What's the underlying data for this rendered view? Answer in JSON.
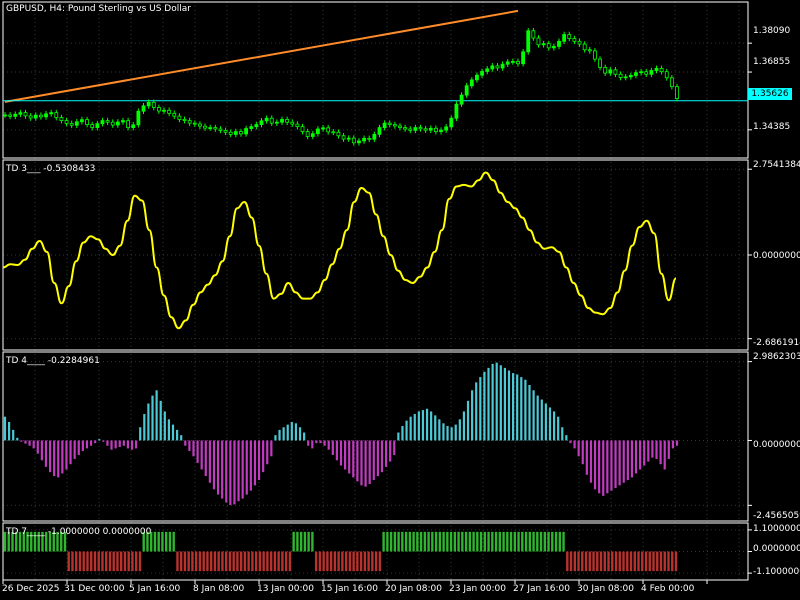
{
  "header": {
    "symbol_title": "GBPUSD, H4:  Pound Sterling vs US Dollar",
    "current_price": "1.35626"
  },
  "colors": {
    "background": "#000000",
    "grid": "#2e3a2e",
    "frame": "#ffffff",
    "bull_candle": "#00ff00",
    "trendline": "#ff8c28",
    "price_line": "#00ffff",
    "td3_line": "#ffff00",
    "td4_pos": "#4dc9d6",
    "td4_neg": "#c23cc2",
    "td7_up": "#2fb52f",
    "td7_down": "#b8322e"
  },
  "panes": {
    "price": {
      "y_ticks": [
        "1.38090",
        "1.36855",
        "1.34385"
      ],
      "y_tick_values": [
        1.3809,
        1.36855,
        1.34385
      ],
      "range": [
        1.3318,
        1.3985
      ],
      "trendline": {
        "start": 1.3558,
        "end": 1.3947
      },
      "closes": [
        1.3502,
        1.3496,
        1.3505,
        1.3512,
        1.3498,
        1.3489,
        1.3501,
        1.3494,
        1.3507,
        1.3512,
        1.3491,
        1.3478,
        1.3466,
        1.3458,
        1.3473,
        1.3482,
        1.3461,
        1.3448,
        1.3465,
        1.3478,
        1.3471,
        1.3459,
        1.3472,
        1.3478,
        1.3448,
        1.346,
        1.3518,
        1.3541,
        1.3556,
        1.3534,
        1.3519,
        1.3522,
        1.3509,
        1.3497,
        1.3483,
        1.3478,
        1.3467,
        1.3463,
        1.3454,
        1.3446,
        1.3448,
        1.3442,
        1.3436,
        1.3428,
        1.3419,
        1.3431,
        1.3421,
        1.3444,
        1.3452,
        1.3461,
        1.3477,
        1.3488,
        1.3467,
        1.3471,
        1.3483,
        1.3471,
        1.3463,
        1.3452,
        1.3431,
        1.341,
        1.3422,
        1.3442,
        1.3447,
        1.343,
        1.3428,
        1.3413,
        1.3399,
        1.3403,
        1.3383,
        1.3391,
        1.3402,
        1.3398,
        1.3419,
        1.3448,
        1.3467,
        1.3461,
        1.3455,
        1.3448,
        1.3442,
        1.3436,
        1.3448,
        1.3443,
        1.3437,
        1.3445,
        1.3431,
        1.3437,
        1.3451,
        1.3488,
        1.3548,
        1.3587,
        1.3627,
        1.3652,
        1.3672,
        1.3688,
        1.3699,
        1.3712,
        1.3703,
        1.3719,
        1.3729,
        1.3731,
        1.3721,
        1.3772,
        1.3862,
        1.3831,
        1.3802,
        1.3807,
        1.3789,
        1.3795,
        1.3817,
        1.3846,
        1.3829,
        1.3817,
        1.3805,
        1.3781,
        1.3776,
        1.3741,
        1.3705,
        1.3681,
        1.3695,
        1.3676,
        1.3662,
        1.3665,
        1.3671,
        1.3683,
        1.3687,
        1.3676,
        1.3692,
        1.3701,
        1.3687,
        1.3661,
        1.3623,
        1.3572
      ]
    },
    "td3": {
      "title": "TD 3___  -0.5308433",
      "y_ticks": [
        "2.7541384",
        "0.0000000",
        "-2.6861914"
      ],
      "y_tick_values": [
        2.7541384,
        0,
        -2.6861914
      ],
      "range": [
        -3.05,
        3.05
      ],
      "values": [
        -0.4,
        -0.3,
        -0.32,
        -0.15,
        0.2,
        0.45,
        0.1,
        -0.9,
        -1.55,
        -1.0,
        -0.2,
        0.4,
        0.6,
        0.5,
        0.2,
        0.0,
        0.3,
        1.1,
        1.9,
        1.75,
        0.8,
        -0.4,
        -1.3,
        -2.0,
        -2.35,
        -2.1,
        -1.6,
        -1.2,
        -0.95,
        -0.65,
        -0.2,
        0.6,
        1.5,
        1.7,
        1.2,
        0.3,
        -0.6,
        -1.4,
        -1.25,
        -0.9,
        -1.2,
        -1.4,
        -1.4,
        -1.2,
        -0.8,
        -0.3,
        0.2,
        0.8,
        1.7,
        2.15,
        2.0,
        1.3,
        0.6,
        0.0,
        -0.5,
        -0.8,
        -0.9,
        -0.7,
        -0.4,
        0.1,
        0.8,
        1.8,
        2.2,
        2.25,
        2.2,
        2.4,
        2.65,
        2.4,
        2.0,
        1.7,
        1.5,
        1.2,
        0.8,
        0.4,
        0.2,
        0.25,
        0.1,
        -0.4,
        -0.9,
        -1.3,
        -1.7,
        -1.85,
        -1.9,
        -1.7,
        -1.2,
        -0.5,
        0.3,
        0.9,
        1.1,
        0.7,
        -0.6,
        -1.45,
        -0.75
      ]
    },
    "td4": {
      "title": "TD 4____  -0.2284961",
      "y_ticks": [
        "2.9862303",
        "0.0000000",
        "-2.4565059"
      ],
      "y_tick_values": [
        2.9862303,
        0,
        -2.4565059
      ],
      "range": [
        -3.05,
        3.35
      ],
      "values": [
        0.9,
        0.7,
        0.4,
        0.1,
        -0.05,
        -0.12,
        -0.2,
        -0.3,
        -0.5,
        -0.75,
        -1.0,
        -1.2,
        -1.35,
        -1.4,
        -1.25,
        -1.1,
        -0.9,
        -0.7,
        -0.55,
        -0.4,
        -0.3,
        -0.2,
        -0.1,
        0.05,
        -0.05,
        -0.2,
        -0.35,
        -0.3,
        -0.25,
        -0.2,
        -0.3,
        -0.35,
        -0.3,
        0.5,
        1.0,
        1.4,
        1.7,
        1.9,
        1.5,
        1.1,
        0.8,
        0.6,
        0.4,
        0.2,
        -0.2,
        -0.4,
        -0.6,
        -0.85,
        -1.1,
        -1.35,
        -1.6,
        -1.85,
        -2.05,
        -2.2,
        -2.35,
        -2.45,
        -2.42,
        -2.3,
        -2.2,
        -2.05,
        -1.9,
        -1.7,
        -1.5,
        -1.2,
        -0.9,
        -0.6,
        0.2,
        0.4,
        0.5,
        0.6,
        0.7,
        0.65,
        0.5,
        0.3,
        -0.2,
        -0.3,
        -0.1,
        -0.1,
        -0.2,
        -0.35,
        -0.55,
        -0.75,
        -0.95,
        -1.1,
        -1.25,
        -1.4,
        -1.55,
        -1.7,
        -1.75,
        -1.65,
        -1.5,
        -1.35,
        -1.2,
        -1.0,
        -0.8,
        -0.55,
        0.3,
        0.55,
        0.75,
        0.9,
        1.0,
        1.1,
        1.15,
        1.2,
        1.1,
        0.95,
        0.8,
        0.65,
        0.55,
        0.5,
        0.6,
        0.8,
        1.1,
        1.5,
        1.9,
        2.2,
        2.4,
        2.6,
        2.75,
        2.9,
        2.95,
        2.85,
        2.75,
        2.65,
        2.55,
        2.5,
        2.4,
        2.3,
        2.1,
        1.9,
        1.7,
        1.55,
        1.4,
        1.25,
        1.1,
        0.9,
        0.5,
        0.2,
        -0.1,
        -0.3,
        -0.6,
        -0.9,
        -1.3,
        -1.6,
        -1.85,
        -2.0,
        -2.1,
        -2.0,
        -1.9,
        -1.8,
        -1.7,
        -1.6,
        -1.5,
        -1.4,
        -1.25,
        -1.1,
        -0.95,
        -0.8,
        -0.65,
        -0.7,
        -0.9,
        -1.1,
        -0.7,
        -0.3,
        -0.2
      ]
    },
    "td7": {
      "title": "TD 7____  -1.0000000  0.0000000",
      "y_ticks": [
        "1.1000000",
        "0.0000000",
        "-1.1000000"
      ],
      "y_tick_values": [
        1.1,
        0,
        -1.1
      ],
      "range": [
        -1.45,
        1.45
      ],
      "values": [
        1,
        1,
        1,
        1,
        1,
        1,
        1,
        1,
        1,
        1,
        1,
        1,
        1,
        1,
        1,
        1,
        1,
        -1,
        -1,
        -1,
        -1,
        -1,
        -1,
        -1,
        -1,
        -1,
        -1,
        -1,
        -1,
        -1,
        -1,
        -1,
        -1,
        -1,
        -1,
        -1,
        -1,
        1,
        1,
        1,
        1,
        1,
        1,
        1,
        1,
        1,
        -1,
        -1,
        -1,
        -1,
        -1,
        -1,
        -1,
        -1,
        -1,
        -1,
        -1,
        -1,
        -1,
        -1,
        -1,
        -1,
        -1,
        -1,
        -1,
        -1,
        -1,
        -1,
        -1,
        -1,
        -1,
        -1,
        -1,
        -1,
        -1,
        -1,
        -1,
        1,
        1,
        1,
        1,
        1,
        1,
        -1,
        -1,
        -1,
        -1,
        -1,
        -1,
        -1,
        -1,
        -1,
        -1,
        -1,
        -1,
        -1,
        -1,
        -1,
        -1,
        -1,
        -1,
        1,
        1,
        1,
        1,
        1,
        1,
        1,
        1,
        1,
        1,
        1,
        1,
        1,
        1,
        1,
        1,
        1,
        1,
        1,
        1,
        1,
        1,
        1,
        1,
        1,
        1,
        1,
        1,
        1,
        1,
        1,
        1,
        1,
        1,
        1,
        1,
        1,
        1,
        1,
        1,
        1,
        1,
        1,
        1,
        1,
        1,
        1,
        1,
        1,
        -1,
        -1,
        -1,
        -1,
        -1,
        -1,
        -1,
        -1,
        -1,
        -1,
        -1,
        -1,
        -1,
        -1,
        -1,
        -1,
        -1,
        -1,
        -1,
        -1,
        -1,
        -1,
        -1,
        -1,
        -1,
        -1,
        -1,
        -1,
        -1,
        -1
      ]
    }
  },
  "x_axis": {
    "labels": [
      "26 Dec 2025",
      "31 Dec 00:00",
      "5 Jan 16:00",
      "8 Jan 08:00",
      "13 Jan 00:00",
      "15 Jan 16:00",
      "20 Jan 08:00",
      "23 Jan 00:00",
      "27 Jan 16:00",
      "30 Jan 08:00",
      "4 Feb 00:00"
    ]
  }
}
